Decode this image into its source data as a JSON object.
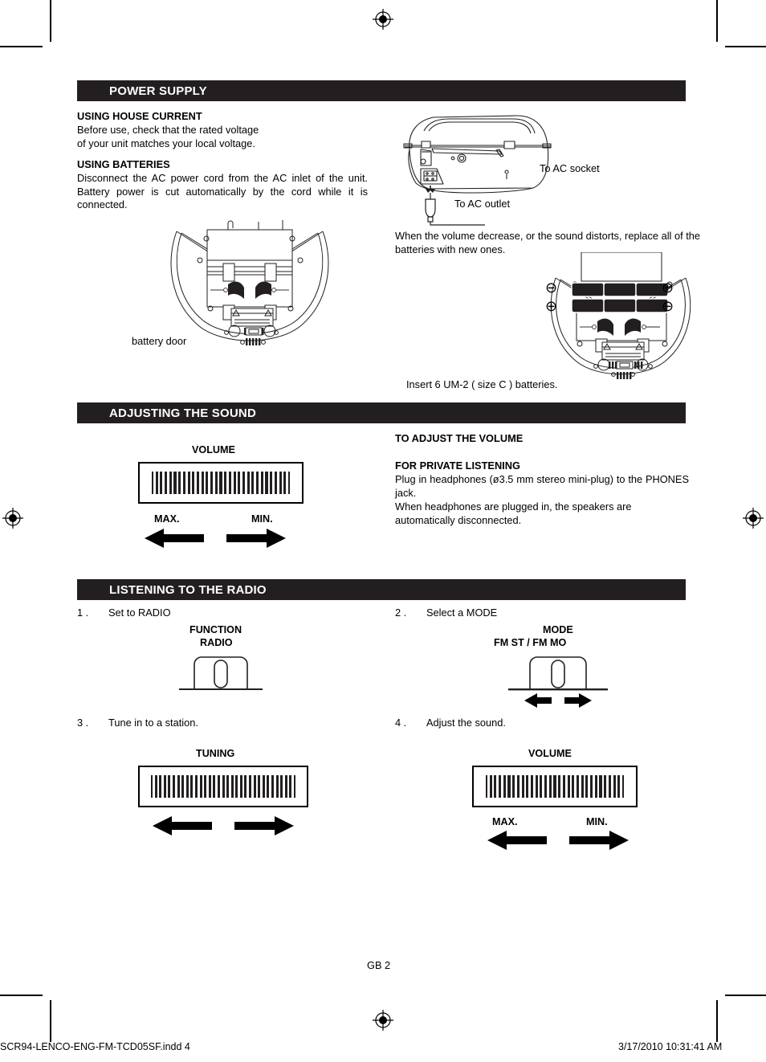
{
  "document": {
    "page_number_label": "GB 2",
    "footer_left": "SCR94-LENCO-ENG-FM-TCD05SF.indd   4",
    "footer_right": "3/17/2010   10:31:41 AM"
  },
  "sections": {
    "power_supply": {
      "heading": "POWER SUPPLY",
      "using_house_current": {
        "heading": "USING HOUSE CURRENT",
        "line1": "Before use, check that the rated voltage",
        "line2": "of your unit matches your local voltage."
      },
      "using_batteries": {
        "heading": "USING BATTERIES",
        "body": "Disconnect the AC power cord from the AC inlet of the unit. Battery power is cut automatically by the cord while it is connected."
      },
      "ac_socket_label": "To AC socket",
      "ac_outlet_label": "To AC outlet",
      "battery_door_label": "battery door",
      "replace_note": "When the volume decrease, or the sound distorts, replace all of the batteries with new ones.",
      "insert_batteries_caption": "Insert 6 UM-2 ( size C ) batteries.",
      "battery_polarity": {
        "top_left": "⊖",
        "bottom_left": "⊕",
        "top_right": "⊕",
        "bottom_right": "⊖"
      }
    },
    "adjusting_the_sound": {
      "heading": "ADJUSTING THE SOUND",
      "volume_label": "VOLUME",
      "max_label": "MAX.",
      "min_label": "MIN.",
      "to_adjust_volume_heading": "TO ADJUST THE VOLUME",
      "for_private_listening_heading": "FOR PRIVATE LISTENING",
      "private_listening_body": "Plug in headphones (ø3.5 mm stereo mini-plug) to the PHONES jack.",
      "private_listening_line2": "When headphones are plugged in, the speakers are",
      "private_listening_line3": "automatically disconnected."
    },
    "listening_to_the_radio": {
      "heading": "LISTENING TO THE RADIO",
      "steps": [
        {
          "number": "1 .",
          "text": "Set to RADIO"
        },
        {
          "number": "2 .",
          "text": "Select a MODE"
        },
        {
          "number": "3 .",
          "text": "Tune in to a station."
        },
        {
          "number": "4 .",
          "text": "Adjust the sound."
        }
      ],
      "function_label": "FUNCTION",
      "function_value": "RADIO",
      "mode_label": "MODE",
      "mode_value": "FM ST / FM MO",
      "tuning_label": "TUNING",
      "volume_label": "VOLUME",
      "max_label": "MAX.",
      "min_label": "MIN."
    }
  },
  "colors": {
    "bar_background": "#231f20",
    "bar_text": "#ffffff",
    "ink": "#000000",
    "paper": "#ffffff"
  }
}
